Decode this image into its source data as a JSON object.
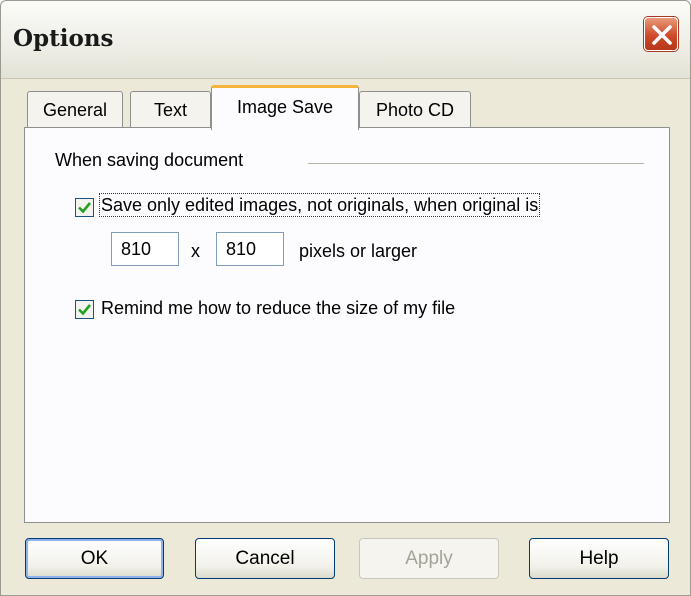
{
  "window": {
    "title": "Options"
  },
  "tabs": [
    {
      "label": "General",
      "active": false
    },
    {
      "label": "Text",
      "active": false
    },
    {
      "label": "Image Save",
      "active": true
    },
    {
      "label": "Photo CD",
      "active": false
    }
  ],
  "group": {
    "label": "When saving document",
    "save_edited": {
      "checked": true,
      "label": "Save only edited images, not originals, when original is"
    },
    "width_value": "810",
    "times": "x",
    "height_value": "810",
    "suffix": "pixels or larger",
    "remind": {
      "checked": true,
      "label": "Remind me how to reduce the size of my file"
    }
  },
  "buttons": {
    "ok": "OK",
    "cancel": "Cancel",
    "apply": "Apply",
    "help": "Help"
  },
  "colors": {
    "close_button": "#cf4a28",
    "active_tab_accent": "#f6b43a",
    "checkmark": "#21a121",
    "dialog_background": "#ece9d8"
  }
}
